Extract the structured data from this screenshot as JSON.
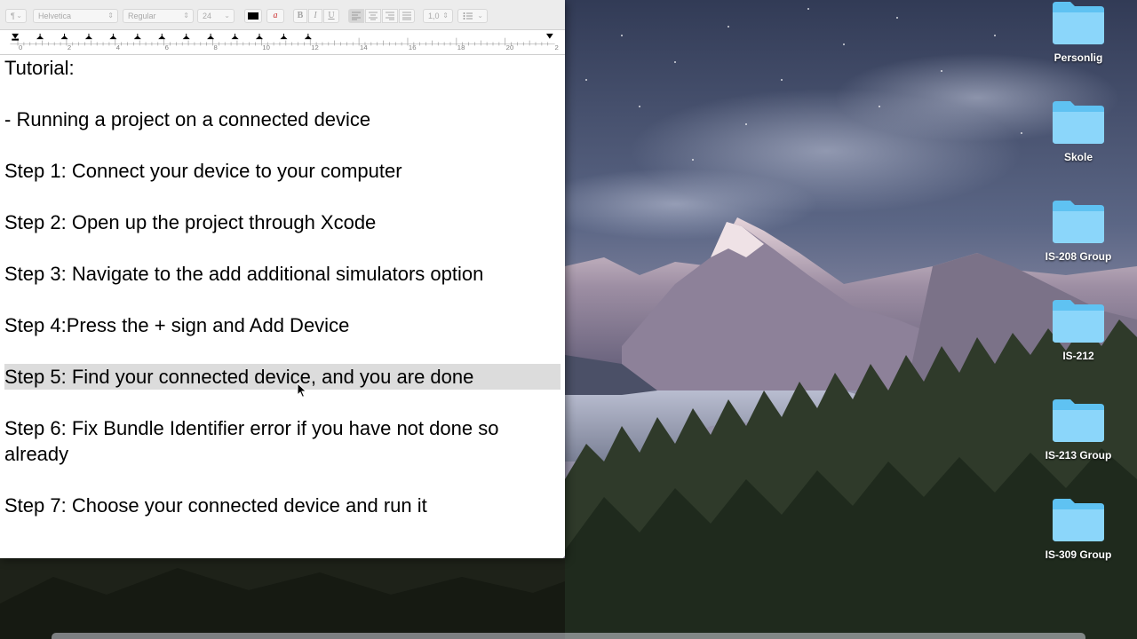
{
  "editor": {
    "toolbar": {
      "paragraph_style": "¶",
      "font_family": "Helvetica",
      "font_style": "Regular",
      "font_size": "24",
      "bold_label": "B",
      "italic_label": "I",
      "underline_label": "U",
      "line_spacing": "1,0"
    },
    "ruler": {
      "labels": [
        "0",
        "2",
        "4",
        "6",
        "8",
        "10",
        "12",
        "14",
        "16",
        "18",
        "20",
        "2"
      ]
    },
    "document": {
      "lines": [
        "Tutorial:",
        "- Running a project on a connected device",
        "Step 1: Connect your device to your computer",
        "Step 2: Open up the project through Xcode",
        "Step 3: Navigate to the add additional simulators option",
        "Step 4:Press the + sign and Add Device",
        "Step 5: Find your connected device, and you are done",
        "Step 6: Fix Bundle Identifier error if you have not done so",
        "already",
        "Step 7: Choose your connected device and run it"
      ],
      "selected_line_index": 6
    }
  },
  "desktop": {
    "folders": [
      {
        "label": "Personlig"
      },
      {
        "label": "Skole"
      },
      {
        "label": "IS-208 Group"
      },
      {
        "label": "IS-212"
      },
      {
        "label": "IS-213 Group"
      },
      {
        "label": "IS-309 Group"
      }
    ],
    "folder_color": "#5fc2f2"
  }
}
